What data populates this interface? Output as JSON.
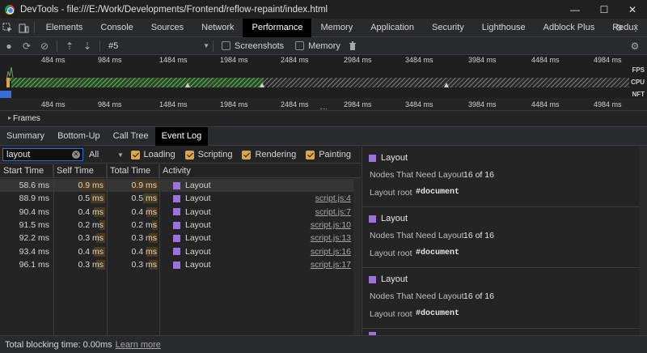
{
  "window": {
    "title": "DevTools - file:///E:/Work/Developments/Frontend/reflow-repaint/index.html",
    "minimize": "—",
    "maximize": "☐",
    "close": "✕"
  },
  "tabs": [
    "Elements",
    "Console",
    "Sources",
    "Network",
    "Performance",
    "Memory",
    "Application",
    "Security",
    "Lighthouse",
    "Adblock Plus",
    "Redux"
  ],
  "active_tab": "Performance",
  "perf_toolbar": {
    "profile": "#5",
    "screenshots_label": "Screenshots",
    "memory_label": "Memory"
  },
  "overview": {
    "ruler_top": [
      "484 ms",
      "984 ms",
      "1484 ms",
      "1984 ms",
      "2484 ms",
      "2984 ms",
      "3484 ms",
      "3984 ms",
      "4484 ms",
      "4984 ms"
    ],
    "ruler_bottom": [
      "484 ms",
      "984 ms",
      "1484 ms",
      "1984 ms",
      "2484 ms",
      "2984 ms",
      "3484 ms",
      "3984 ms",
      "4484 ms",
      "4984 ms"
    ],
    "fps": "FPS",
    "cpu": "CPU",
    "nft": "NFT"
  },
  "frames_label": "Frames",
  "subtabs": [
    "Summary",
    "Bottom-Up",
    "Call Tree",
    "Event Log"
  ],
  "active_subtab": "Event Log",
  "filter": {
    "value": "layout",
    "select": "All",
    "categories": [
      {
        "label": "Loading",
        "checked": true
      },
      {
        "label": "Scripting",
        "checked": true
      },
      {
        "label": "Rendering",
        "checked": true
      },
      {
        "label": "Painting",
        "checked": true
      }
    ]
  },
  "table": {
    "headers": [
      "Start Time",
      "Self Time",
      "Total Time",
      "Activity"
    ],
    "rows": [
      {
        "start": "58.6 ms",
        "self": "0.9 ms",
        "total": "0.9 ms",
        "activity": "Layout",
        "source": ""
      },
      {
        "start": "88.9 ms",
        "self": "0.5 ms",
        "total": "0.5 ms",
        "activity": "Layout",
        "source": "script.js:4"
      },
      {
        "start": "90.4 ms",
        "self": "0.4 ms",
        "total": "0.4 ms",
        "activity": "Layout",
        "source": "script.js:7"
      },
      {
        "start": "91.5 ms",
        "self": "0.2 ms",
        "total": "0.2 ms",
        "activity": "Layout",
        "source": "script.js:10"
      },
      {
        "start": "92.2 ms",
        "self": "0.3 ms",
        "total": "0.3 ms",
        "activity": "Layout",
        "source": "script.js:13"
      },
      {
        "start": "93.4 ms",
        "self": "0.4 ms",
        "total": "0.4 ms",
        "activity": "Layout",
        "source": "script.js:16"
      },
      {
        "start": "96.1 ms",
        "self": "0.3 ms",
        "total": "0.3 ms",
        "activity": "Layout",
        "source": "script.js:17"
      }
    ]
  },
  "details": [
    {
      "title": "Layout",
      "nodes_label": "Nodes That Need Layout",
      "nodes_value": "16 of 16",
      "root_label": "Layout root",
      "root_value": "#document"
    },
    {
      "title": "Layout",
      "nodes_label": "Nodes That Need Layout",
      "nodes_value": "16 of 16",
      "root_label": "Layout root",
      "root_value": "#document"
    },
    {
      "title": "Layout",
      "nodes_label": "Nodes That Need Layout",
      "nodes_value": "16 of 16",
      "root_label": "Layout root",
      "root_value": "#document"
    }
  ],
  "status": {
    "text": "Total blocking time: 0.00ms",
    "link": "Learn more"
  },
  "colors": {
    "layout": "#9a74d6",
    "accent": "#d9a54f",
    "active_tab_bg": "#000000"
  }
}
